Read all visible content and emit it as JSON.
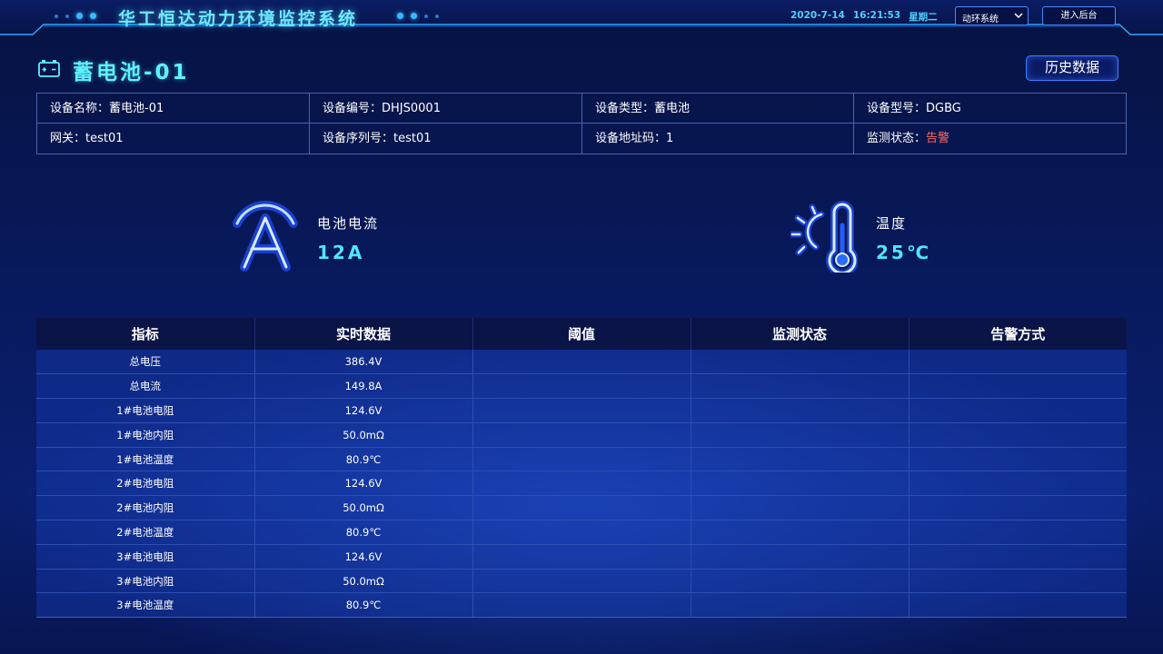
{
  "header": {
    "system_title": "华工恒达动力环境监控系统",
    "date": "2020-7-14",
    "time": "16:21:53",
    "weekday": "星期二",
    "system_select": "动环系统",
    "admin_button": "进入后台"
  },
  "page": {
    "title": "蓄电池-01",
    "history_button": "历史数据"
  },
  "info": [
    {
      "label": "设备名称：",
      "value": "蓄电池-01"
    },
    {
      "label": "设备编号：",
      "value": "DHJS0001"
    },
    {
      "label": "设备类型：",
      "value": "蓄电池"
    },
    {
      "label": "设备型号：",
      "value": "DGBG"
    },
    {
      "label": "网关：",
      "value": "test01"
    },
    {
      "label": "设备序列号：",
      "value": "test01"
    },
    {
      "label": "设备地址码：",
      "value": "1"
    },
    {
      "label": "监测状态：",
      "value": "告警",
      "status": "alarm"
    }
  ],
  "metrics": {
    "current": {
      "label": "电池电流",
      "value": "12A",
      "icon": "ammeter-icon"
    },
    "temperature": {
      "label": "温度",
      "value": "25℃",
      "icon": "thermometer-sun-icon"
    }
  },
  "table": {
    "headers": [
      "指标",
      "实时数据",
      "阈值",
      "监测状态",
      "告警方式"
    ],
    "rows": [
      [
        "总电压",
        "386.4V",
        "",
        "",
        ""
      ],
      [
        "总电流",
        "149.8A",
        "",
        "",
        ""
      ],
      [
        "1#电池电阻",
        "124.6V",
        "",
        "",
        ""
      ],
      [
        "1#电池内阻",
        "50.0mΩ",
        "",
        "",
        ""
      ],
      [
        "1#电池温度",
        "80.9℃",
        "",
        "",
        ""
      ],
      [
        "2#电池电阻",
        "124.6V",
        "",
        "",
        ""
      ],
      [
        "2#电池内阻",
        "50.0mΩ",
        "",
        "",
        ""
      ],
      [
        "2#电池温度",
        "80.9℃",
        "",
        "",
        ""
      ],
      [
        "3#电池电阻",
        "124.6V",
        "",
        "",
        ""
      ],
      [
        "3#电池内阻",
        "50.0mΩ",
        "",
        "",
        ""
      ],
      [
        "3#电池温度",
        "80.9℃",
        "",
        "",
        ""
      ]
    ]
  },
  "colors": {
    "accent": "#5ff0ff",
    "alarm": "#ff6b6b",
    "border": "#4b64b0"
  }
}
